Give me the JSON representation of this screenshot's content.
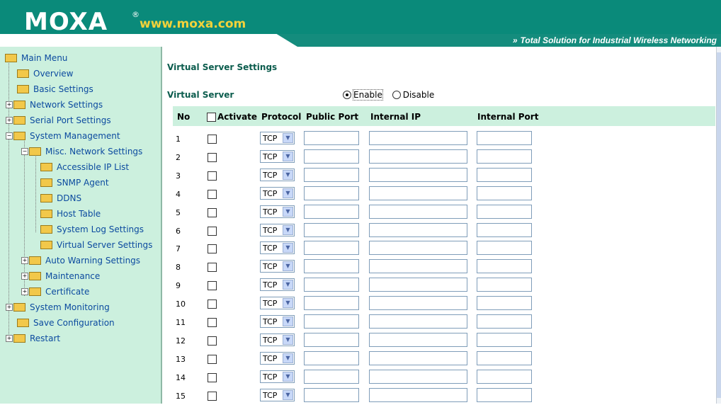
{
  "header": {
    "logo": "MOXA",
    "reg_mark": "®",
    "site": "www.moxa.com",
    "tagline_chevron": "»",
    "tagline": "Total Solution for Industrial Wireless Networking"
  },
  "sidebar": {
    "items": [
      {
        "label": "Main Menu"
      },
      {
        "label": "Overview"
      },
      {
        "label": "Basic Settings"
      },
      {
        "label": "Network Settings"
      },
      {
        "label": "Serial Port Settings"
      },
      {
        "label": "System Management"
      },
      {
        "label": "Misc. Network Settings"
      },
      {
        "label": "Accessible IP List"
      },
      {
        "label": "SNMP Agent"
      },
      {
        "label": "DDNS"
      },
      {
        "label": "Host Table"
      },
      {
        "label": "System Log Settings"
      },
      {
        "label": "Virtual Server Settings"
      },
      {
        "label": "Auto Warning Settings"
      },
      {
        "label": "Maintenance"
      },
      {
        "label": "Certificate"
      },
      {
        "label": "System Monitoring"
      },
      {
        "label": "Save Configuration"
      },
      {
        "label": "Restart"
      }
    ]
  },
  "main": {
    "title": "Virtual Server Settings",
    "virtual_server_label": "Virtual Server",
    "enable_label": "Enable",
    "disable_label": "Disable",
    "selected": "Enable",
    "columns": {
      "no": "No",
      "activate": "Activate",
      "protocol": "Protocol",
      "public_port": "Public Port",
      "internal_ip": "Internal IP",
      "internal_port": "Internal Port"
    },
    "rows": [
      {
        "no": "1",
        "protocol": "TCP"
      },
      {
        "no": "2",
        "protocol": "TCP"
      },
      {
        "no": "3",
        "protocol": "TCP"
      },
      {
        "no": "4",
        "protocol": "TCP"
      },
      {
        "no": "5",
        "protocol": "TCP"
      },
      {
        "no": "6",
        "protocol": "TCP"
      },
      {
        "no": "7",
        "protocol": "TCP"
      },
      {
        "no": "8",
        "protocol": "TCP"
      },
      {
        "no": "9",
        "protocol": "TCP"
      },
      {
        "no": "10",
        "protocol": "TCP"
      },
      {
        "no": "11",
        "protocol": "TCP"
      },
      {
        "no": "12",
        "protocol": "TCP"
      },
      {
        "no": "13",
        "protocol": "TCP"
      },
      {
        "no": "14",
        "protocol": "TCP"
      },
      {
        "no": "15",
        "protocol": "TCP"
      }
    ]
  },
  "colors": {
    "header_bg": "#0a8a7a",
    "site_yellow": "#f3d23a",
    "sidebar_bg": "#ccf0de",
    "link_blue": "#0b4a9f",
    "title_green": "#0b5c4d"
  }
}
